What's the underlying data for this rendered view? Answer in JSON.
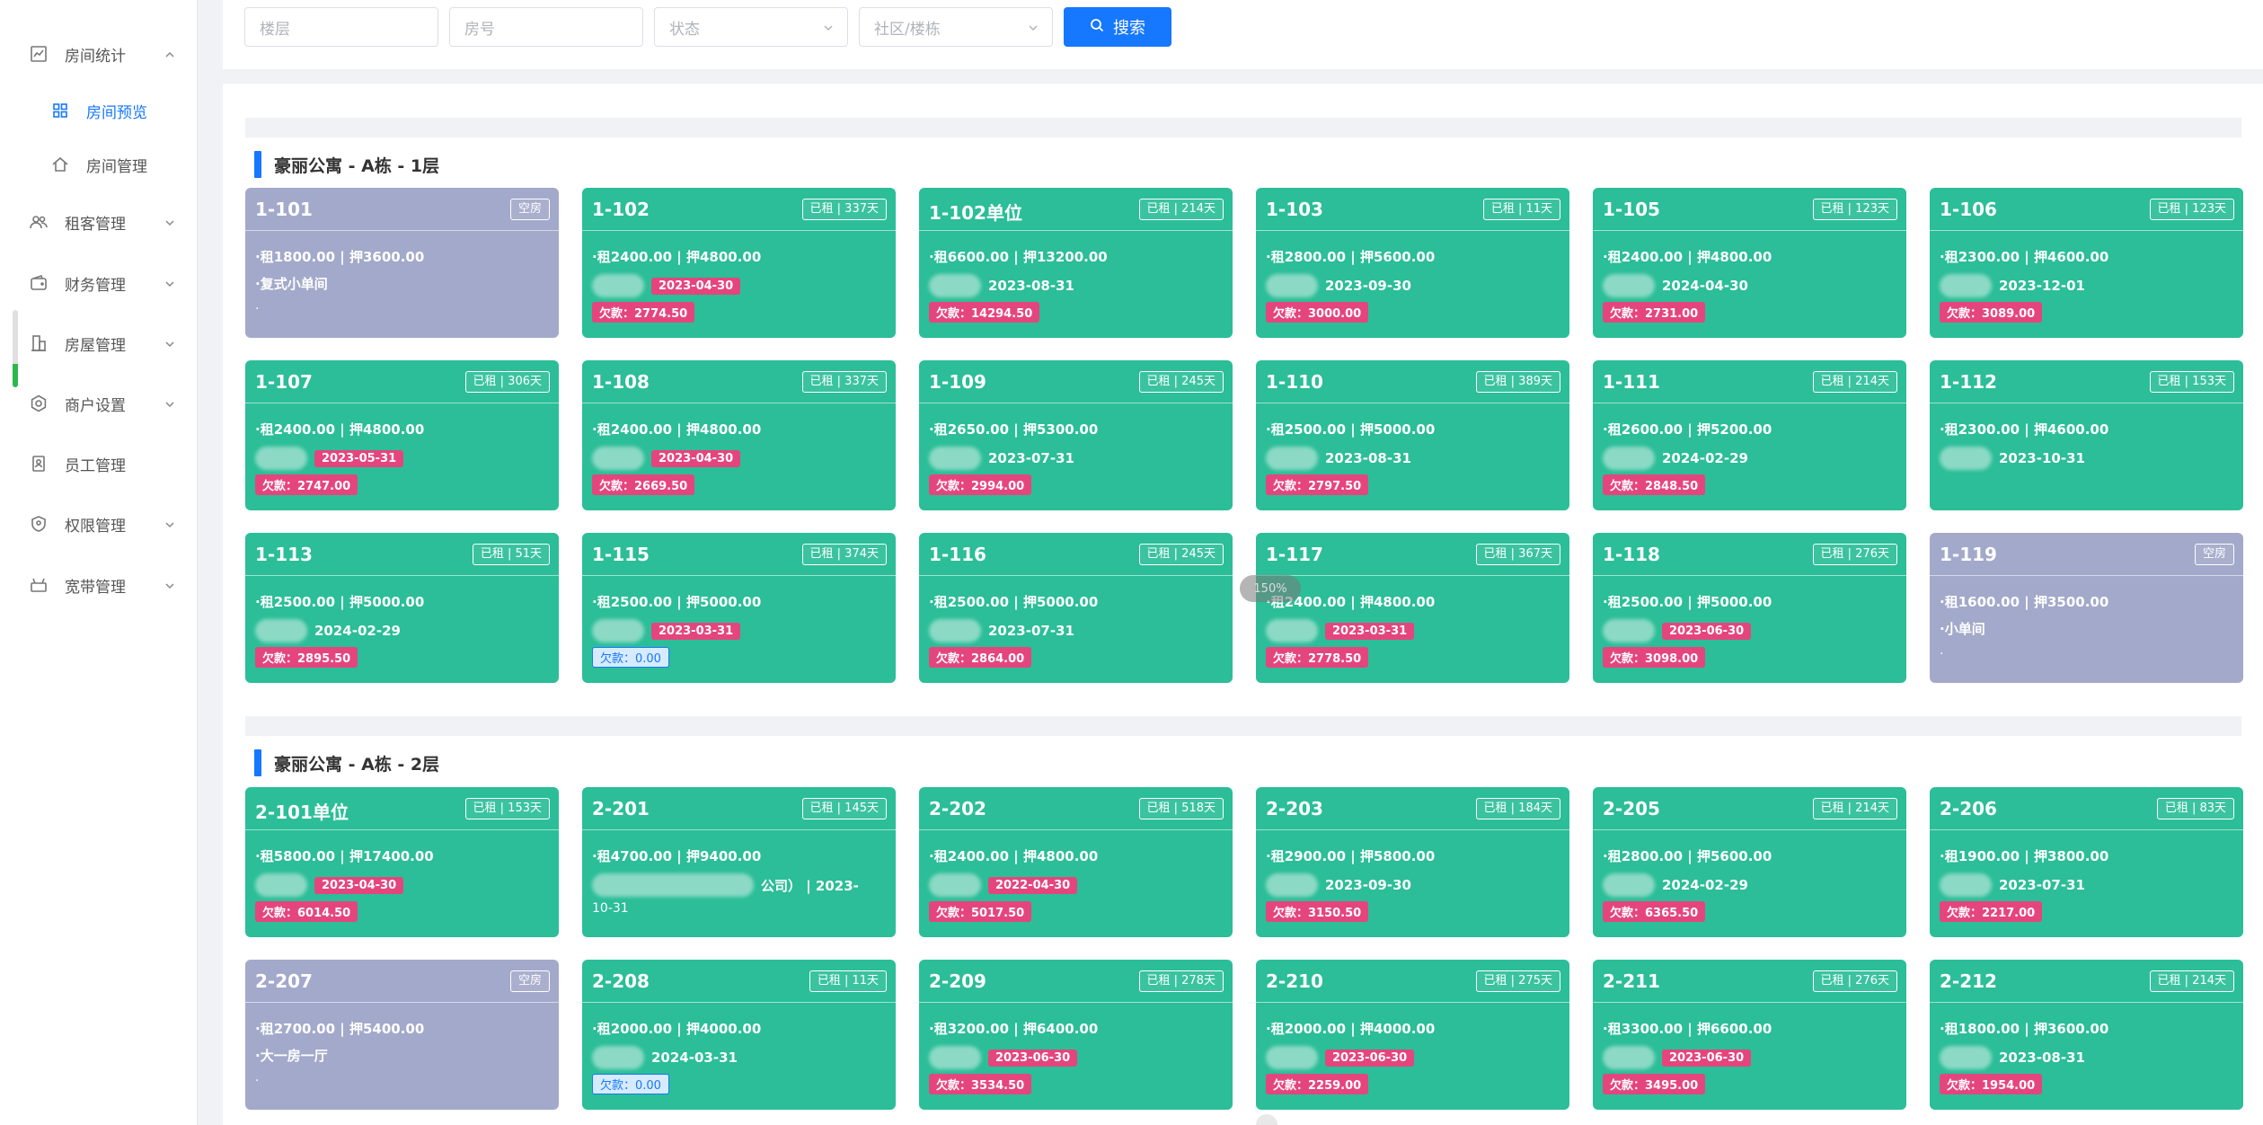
{
  "sidebar": {
    "items": [
      {
        "label": "房间统计",
        "icon": "chart-icon",
        "expanded": true
      },
      {
        "label": "房间预览",
        "icon": "grid-icon",
        "sub": true,
        "active": true
      },
      {
        "label": "房间管理",
        "icon": "house-icon",
        "sub": true
      },
      {
        "label": "租客管理",
        "icon": "users-icon"
      },
      {
        "label": "财务管理",
        "icon": "wallet-icon"
      },
      {
        "label": "房屋管理",
        "icon": "building-icon"
      },
      {
        "label": "商户设置",
        "icon": "gear-icon"
      },
      {
        "label": "员工管理",
        "icon": "badge-icon"
      },
      {
        "label": "权限管理",
        "icon": "shield-icon"
      },
      {
        "label": "宽带管理",
        "icon": "router-icon"
      }
    ]
  },
  "search": {
    "floor_placeholder": "楼层",
    "room_placeholder": "房号",
    "status_placeholder": "状态",
    "community_placeholder": "社区/楼栋",
    "button_label": "搜索"
  },
  "zoom_label": "150%",
  "floors": [
    {
      "title": "豪丽公寓 - A栋 - 1层",
      "rooms": [
        {
          "num": "1-101",
          "status": "空房",
          "vacant": true,
          "rent": "·租1800.00 | 押3600.00",
          "line2": "·复式小单间",
          "line3": "·"
        },
        {
          "num": "1-102",
          "status": "已租 | 337天",
          "rent": "·租2400.00 | 押4800.00",
          "date": "2023-04-30",
          "debt": "欠款：2774.50"
        },
        {
          "num": "1-102单位",
          "status": "已租 | 214天",
          "rent": "·租6600.00 | 押13200.00",
          "date_plain": "2023-08-31",
          "debt": "欠款：14294.50"
        },
        {
          "num": "1-103",
          "status": "已租 | 11天",
          "rent": "·租2800.00 | 押5600.00",
          "date_plain": "2023-09-30",
          "debt": "欠款：3000.00"
        },
        {
          "num": "1-105",
          "status": "已租 | 123天",
          "rent": "·租2400.00 | 押4800.00",
          "date_plain": "2024-04-30",
          "debt": "欠款：2731.00"
        },
        {
          "num": "1-106",
          "status": "已租 | 123天",
          "rent": "·租2300.00 | 押4600.00",
          "date_plain": "2023-12-01",
          "debt": "欠款：3089.00"
        },
        {
          "num": "1-107",
          "status": "已租 | 306天",
          "rent": "·租2400.00 | 押4800.00",
          "date": "2023-05-31",
          "debt": "欠款：2747.00"
        },
        {
          "num": "1-108",
          "status": "已租 | 337天",
          "rent": "·租2400.00 | 押4800.00",
          "date": "2023-04-30",
          "debt": "欠款：2669.50"
        },
        {
          "num": "1-109",
          "status": "已租 | 245天",
          "rent": "·租2650.00 | 押5300.00",
          "date_plain": "2023-07-31",
          "debt": "欠款：2994.00"
        },
        {
          "num": "1-110",
          "status": "已租 | 389天",
          "rent": "·租2500.00 | 押5000.00",
          "date_plain": "2023-08-31",
          "debt": "欠款：2797.50"
        },
        {
          "num": "1-111",
          "status": "已租 | 214天",
          "rent": "·租2600.00 | 押5200.00",
          "date_plain": "2024-02-29",
          "debt": "欠款：2848.50"
        },
        {
          "num": "1-112",
          "status": "已租 | 153天",
          "rent": "·租2300.00 | 押4600.00",
          "date_plain": "2023-10-31",
          "debt": ""
        },
        {
          "num": "1-113",
          "status": "已租 | 51天",
          "rent": "·租2500.00 | 押5000.00",
          "date_plain": "2024-02-29",
          "debt": "欠款：2895.50"
        },
        {
          "num": "1-115",
          "status": "已租 | 374天",
          "rent": "·租2500.00 | 押5000.00",
          "date": "2023-03-31",
          "debt_blue": "欠款：0.00"
        },
        {
          "num": "1-116",
          "status": "已租 | 245天",
          "rent": "·租2500.00 | 押5000.00",
          "date_plain": "2023-07-31",
          "debt": "欠款：2864.00"
        },
        {
          "num": "1-117",
          "status": "已租 | 367天",
          "rent": "·租2400.00 | 押4800.00",
          "date": "2023-03-31",
          "debt": "欠款：2778.50"
        },
        {
          "num": "1-118",
          "status": "已租 | 276天",
          "rent": "·租2500.00 | 押5000.00",
          "date": "2023-06-30",
          "debt": "欠款：3098.00"
        },
        {
          "num": "1-119",
          "status": "空房",
          "vacant": true,
          "rent": "·租1600.00 | 押3500.00",
          "line2": "·小单间",
          "line3": "·"
        }
      ]
    },
    {
      "title": "豪丽公寓 - A栋 - 2层",
      "rooms": [
        {
          "num": "2-101单位",
          "status": "已租 | 153天",
          "rent": "·租5800.00 | 押17400.00",
          "date": "2023-04-30",
          "debt": "欠款：6014.50"
        },
        {
          "num": "2-201",
          "status": "已租 | 145天",
          "rent": "·租4700.00 | 押9400.00",
          "line2": "公司） | 2023-",
          "line3_plain": "10-31"
        },
        {
          "num": "2-202",
          "status": "已租 | 518天",
          "rent": "·租2400.00 | 押4800.00",
          "date": "2022-04-30",
          "debt": "欠款：5017.50"
        },
        {
          "num": "2-203",
          "status": "已租 | 184天",
          "rent": "·租2900.00 | 押5800.00",
          "date_plain": "2023-09-30",
          "debt": "欠款：3150.50"
        },
        {
          "num": "2-205",
          "status": "已租 | 214天",
          "rent": "·租2800.00 | 押5600.00",
          "date_plain": "2024-02-29",
          "debt": "欠款：6365.50"
        },
        {
          "num": "2-206",
          "status": "已租 | 83天",
          "rent": "·租1900.00 | 押3800.00",
          "date_plain": "2023-07-31",
          "debt": "欠款：2217.00"
        },
        {
          "num": "2-207",
          "status": "空房",
          "vacant": true,
          "rent": "·租2700.00 | 押5400.00",
          "line2": "·大一房一厅",
          "line3": "·"
        },
        {
          "num": "2-208",
          "status": "已租 | 11天",
          "rent": "·租2000.00 | 押4000.00",
          "date_plain": "2024-03-31",
          "debt_blue": "欠款：0.00"
        },
        {
          "num": "2-209",
          "status": "已租 | 278天",
          "rent": "·租3200.00 | 押6400.00",
          "date": "2023-06-30",
          "debt": "欠款：3534.50"
        },
        {
          "num": "2-210",
          "status": "已租 | 275天",
          "rent": "·租2000.00 | 押4000.00",
          "date": "2023-06-30",
          "debt": "欠款：2259.00"
        },
        {
          "num": "2-211",
          "status": "已租 | 276天",
          "rent": "·租3300.00 | 押6600.00",
          "date": "2023-06-30",
          "debt": "欠款：3495.00"
        },
        {
          "num": "2-212",
          "status": "已租 | 214天",
          "rent": "·租1800.00 | 押3600.00",
          "date_plain": "2023-08-31",
          "debt": "欠款：1954.00"
        }
      ]
    }
  ]
}
